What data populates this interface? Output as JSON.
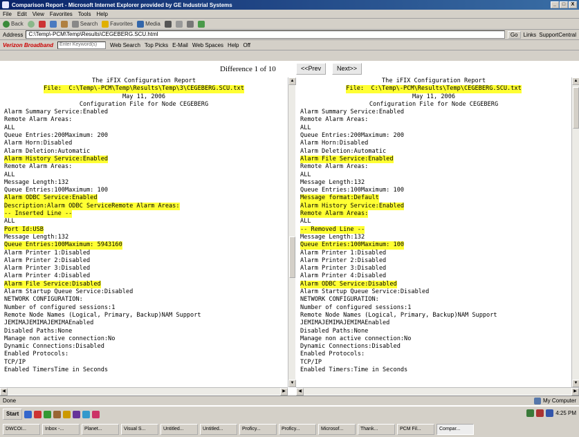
{
  "window": {
    "title": "Comparison Report - Microsoft Internet Explorer provided by GE Industrial Systems",
    "buttons": [
      "_",
      "□",
      "X"
    ]
  },
  "menu": [
    "File",
    "Edit",
    "View",
    "Favorites",
    "Tools",
    "Help"
  ],
  "toolbar": {
    "back": "Back",
    "search": "Search",
    "favorites": "Favorites",
    "media": "Media"
  },
  "address": {
    "label": "Address",
    "value": "C:\\Temp\\-PCM\\Temp\\Results\\CEGEBERG.SCU.html",
    "go": "Go",
    "links": "Links",
    "support": "SupportCentral"
  },
  "links_bar": {
    "brand": "Verizon Broadband",
    "search_placeholder": "Enter Keyword(s)",
    "web_search": "Web Search",
    "items": [
      "Top Picks",
      "E-Mail",
      "Web Spaces",
      "Help",
      "Off"
    ]
  },
  "compare": {
    "diff_label": "Difference 1 of 10",
    "prev_button": "<<Prev",
    "next_button": "Next>>"
  },
  "left_pane": {
    "lines": [
      {
        "text": "The iFIX Configuration Report",
        "center": true,
        "hl": false
      },
      {
        "text": "File:  C:\\Temp\\-PCM\\Temp\\Results\\Temp\\3\\CEGEBERG.SCU.txt",
        "center": true,
        "hl": true
      },
      {
        "text": "May 11, 2006",
        "center": true,
        "hl": false
      },
      {
        "text": "Configuration File for Node CEGEBERG",
        "center": true,
        "hl": false
      },
      {
        "text": "Alarm Summary Service:Enabled",
        "hl": false
      },
      {
        "text": "Remote Alarm Areas:",
        "hl": false
      },
      {
        "text": "ALL",
        "hl": false
      },
      {
        "text": "Queue Entries:200Maximum: 200",
        "hl": false
      },
      {
        "text": "Alarm Horn:Disabled",
        "hl": false
      },
      {
        "text": "Alarm Deletion:Automatic",
        "hl": false
      },
      {
        "text": "Alarm History Service:Enabled",
        "hl": true
      },
      {
        "text": "Remote Alarm Areas:",
        "hl": false
      },
      {
        "text": "ALL",
        "hl": false
      },
      {
        "text": "Message Length:132",
        "hl": false
      },
      {
        "text": "Queue Entries:100Maximum: 100",
        "hl": false
      },
      {
        "text": "Alarm ODBC Service:Enabled",
        "hl": true
      },
      {
        "text": "Description:Alarm ODBC ServiceRemote Alarm Areas:",
        "hl": true
      },
      {
        "text": "-- Inserted Line --",
        "hl": true
      },
      {
        "text": "ALL",
        "hl": false
      },
      {
        "text": "Port Id:USB",
        "hl": true
      },
      {
        "text": "Message Length:132",
        "hl": false
      },
      {
        "text": "Queue Entries:100Maximum: 5943160",
        "hl": true
      },
      {
        "text": "Alarm Printer 1:Disabled",
        "hl": false
      },
      {
        "text": "Alarm Printer 2:Disabled",
        "hl": false
      },
      {
        "text": "Alarm Printer 3:Disabled",
        "hl": false
      },
      {
        "text": "Alarm Printer 4:Disabled",
        "hl": false
      },
      {
        "text": "Alarm File Service:Disabled",
        "hl": true
      },
      {
        "text": "Alarm Startup Queue Service:Disabled",
        "hl": false
      },
      {
        "text": "NETWORK CONFIGURATION:",
        "hl": false
      },
      {
        "text": "Number of configured sessions:1",
        "hl": false
      },
      {
        "text": "Remote Node Names (Logical, Primary, Backup)NAM Support",
        "hl": false
      },
      {
        "text": "JEMIMAJEMIMAJEMIMAEnabled",
        "hl": false
      },
      {
        "text": "Disabled Paths:None",
        "hl": false
      },
      {
        "text": "Manage non active connection:No",
        "hl": false
      },
      {
        "text": "Dynamic Connections:Disabled",
        "hl": false
      },
      {
        "text": "Enabled Protocols:",
        "hl": false
      },
      {
        "text": "TCP/IP",
        "hl": false
      },
      {
        "text": "Enabled TimersTime in Seconds",
        "hl": false
      }
    ]
  },
  "right_pane": {
    "lines": [
      {
        "text": "The iFIX Configuration Report",
        "center": true,
        "hl": false
      },
      {
        "text": "File:  C:\\Temp\\-PCM\\Results\\Temp\\CEGEBERG.SCU.txt",
        "center": true,
        "hl": true
      },
      {
        "text": "May 11, 2006",
        "center": true,
        "hl": false
      },
      {
        "text": "Configuration File for Node CEGEBERG",
        "center": true,
        "hl": false
      },
      {
        "text": "Alarm Summary Service:Enabled",
        "hl": false
      },
      {
        "text": "Remote Alarm Areas:",
        "hl": false
      },
      {
        "text": "ALL",
        "hl": false
      },
      {
        "text": "Queue Entries:200Maximum: 200",
        "hl": false
      },
      {
        "text": "Alarm Horn:Disabled",
        "hl": false
      },
      {
        "text": "Alarm Deletion:Automatic",
        "hl": false
      },
      {
        "text": "Alarm File Service:Enabled",
        "hl": true
      },
      {
        "text": "Remote Alarm Areas:",
        "hl": false
      },
      {
        "text": "ALL",
        "hl": false
      },
      {
        "text": "Message Length:132",
        "hl": false
      },
      {
        "text": "Queue Entries:100Maximum: 100",
        "hl": false
      },
      {
        "text": "Message format:Default",
        "hl": true
      },
      {
        "text": "Alarm History Service:Enabled",
        "hl": true
      },
      {
        "text": "Remote Alarm Areas:",
        "hl": true
      },
      {
        "text": "ALL",
        "hl": false
      },
      {
        "text": "-- Removed Line --",
        "hl": true
      },
      {
        "text": "Message Length:132",
        "hl": false
      },
      {
        "text": "Queue Entries:100Maximum: 100",
        "hl": true
      },
      {
        "text": "Alarm Printer 1:Disabled",
        "hl": false
      },
      {
        "text": "Alarm Printer 2:Disabled",
        "hl": false
      },
      {
        "text": "Alarm Printer 3:Disabled",
        "hl": false
      },
      {
        "text": "Alarm Printer 4:Disabled",
        "hl": false
      },
      {
        "text": "Alarm ODBC Service:Disabled",
        "hl": true
      },
      {
        "text": "Alarm Startup Queue Service:Disabled",
        "hl": false
      },
      {
        "text": "NETWORK CONFIGURATION:",
        "hl": false
      },
      {
        "text": "Number of configured sessions:1",
        "hl": false
      },
      {
        "text": "Remote Node Names (Logical, Primary, Backup)NAM Support",
        "hl": false
      },
      {
        "text": "JEMIMAJEMIMAJEMIMAEnabled",
        "hl": false
      },
      {
        "text": "Disabled Paths:None",
        "hl": false
      },
      {
        "text": "Manage non active connection:No",
        "hl": false
      },
      {
        "text": "Dynamic Connections:Disabled",
        "hl": false
      },
      {
        "text": "Enabled Protocols:",
        "hl": false
      },
      {
        "text": "TCP/IP",
        "hl": false
      },
      {
        "text": "Enabled Timers:Time in Seconds",
        "hl": false
      }
    ]
  },
  "status": {
    "left": "Done",
    "zone": "My Computer"
  },
  "taskbar": {
    "start": "Start",
    "tasks": [
      "DWCOI...",
      "Inbox -...",
      "Planet...",
      "Visual S...",
      "Untitled...",
      "Untitled...",
      "Proficy...",
      "Proficy...",
      "Microsof...",
      "Thank...",
      "PCM Fil...",
      "Compar..."
    ],
    "clock": "4:25 PM"
  },
  "colors": {
    "highlight": "#ffff33",
    "titlebar": "#0a246a"
  }
}
